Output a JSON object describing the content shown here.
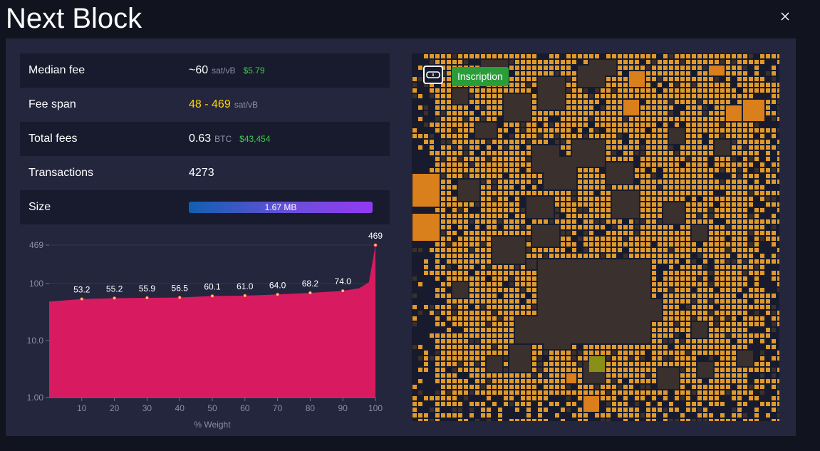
{
  "title": "Next Block",
  "close_icon": "close-icon",
  "stats": {
    "median_fee": {
      "label": "Median fee",
      "value": "~60",
      "unit": "sat/vB",
      "fiat": "$5.79"
    },
    "fee_span": {
      "label": "Fee span",
      "value": "48 - 469",
      "unit": "sat/vB"
    },
    "total_fees": {
      "label": "Total fees",
      "value": "0.63",
      "unit": "BTC",
      "fiat": "$43,454"
    },
    "transactions": {
      "label": "Transactions",
      "value": "4273"
    },
    "size": {
      "label": "Size",
      "value": "1.67 MB",
      "fill_fraction": 1.0
    }
  },
  "chart_data": {
    "type": "area",
    "xlabel": "% Weight",
    "ylabel": "",
    "yscale": "log",
    "ylim": [
      1,
      469
    ],
    "xlim": [
      0,
      100
    ],
    "y_ticks": [
      {
        "value": 1,
        "label": "1.00"
      },
      {
        "value": 10,
        "label": "10.0"
      },
      {
        "value": 100,
        "label": "100"
      },
      {
        "value": 469,
        "label": "469"
      }
    ],
    "x_ticks": [
      10,
      20,
      30,
      40,
      50,
      60,
      70,
      80,
      90,
      100
    ],
    "series": [
      {
        "values_x": [
          0,
          10,
          20,
          30,
          40,
          50,
          60,
          70,
          80,
          90,
          95,
          98,
          100
        ],
        "values_y": [
          48,
          53.2,
          55.2,
          55.9,
          56.5,
          60.1,
          61.0,
          64.0,
          68.2,
          74.0,
          82,
          105,
          469
        ],
        "color": "#d81b60"
      }
    ],
    "annotations": [
      {
        "x": 10,
        "y": 53.2,
        "label": "53.2"
      },
      {
        "x": 20,
        "y": 55.2,
        "label": "55.2"
      },
      {
        "x": 30,
        "y": 55.9,
        "label": "55.9"
      },
      {
        "x": 40,
        "y": 56.5,
        "label": "56.5"
      },
      {
        "x": 50,
        "y": 60.1,
        "label": "60.1"
      },
      {
        "x": 60,
        "y": 61.0,
        "label": "61.0"
      },
      {
        "x": 70,
        "y": 64.0,
        "label": "64.0"
      },
      {
        "x": 80,
        "y": 68.2,
        "label": "68.2"
      },
      {
        "x": 90,
        "y": 74.0,
        "label": "74.0"
      },
      {
        "x": 100,
        "y": 469,
        "label": "469"
      }
    ],
    "grid": true
  },
  "block_visualization": {
    "overlay_icon": "goggles-icon",
    "overlay_badge": "Inscription",
    "colors": {
      "small": "#e09a2b",
      "dark": "#3a302d",
      "bright": "#d97f1c",
      "olive": "#8a8f16",
      "empty": "#181b2d"
    }
  }
}
